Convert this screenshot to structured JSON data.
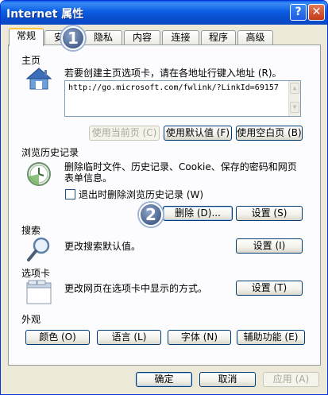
{
  "window": {
    "title": "Internet 属性",
    "help_glyph": "?",
    "close_glyph": "✕"
  },
  "tabs": [
    {
      "label": "常规",
      "active": true
    },
    {
      "label": "安全"
    },
    {
      "label": "隐私"
    },
    {
      "label": "内容"
    },
    {
      "label": "连接"
    },
    {
      "label": "程序"
    },
    {
      "label": "高级"
    }
  ],
  "homepage": {
    "title": "主页",
    "description": "若要创建主页选项卡，请在各地址行键入地址 (R)。",
    "url": "http://go.microsoft.com/fwlink/?LinkId=69157",
    "use_current": "使用当前页 (C)",
    "use_default": "使用默认值 (F)",
    "use_blank": "使用空白页 (B)"
  },
  "history": {
    "title": "浏览历史记录",
    "description_line1": "删除临时文件、历史记录、Cookie、保存的密码和网页",
    "description_line2": "表单信息。",
    "checkbox_label": "退出时删除浏览历史记录 (W)",
    "checkbox_checked": false,
    "delete_button": "删除 (D)...",
    "settings_button": "设置 (S)"
  },
  "search": {
    "title": "搜索",
    "description": "更改搜索默认值。",
    "settings_button": "设置 (I)"
  },
  "tabs_section": {
    "title": "选项卡",
    "description": "更改网页在选项卡中显示的方式。",
    "settings_button": "设置 (T)"
  },
  "appearance": {
    "title": "外观",
    "colors_button": "颜色 (O)",
    "languages_button": "语言 (L)",
    "fonts_button": "字体 (N)",
    "accessibility_button": "辅助功能 (E)"
  },
  "footer": {
    "ok_button": "确定",
    "cancel_button": "取消",
    "apply_button": "应用 (A)"
  },
  "annotations": {
    "step1": "1",
    "step2": "2"
  },
  "colors": {
    "titlebar": "#0a5fe6",
    "badge": "#4a6491",
    "dialog_bg": "#ece9d8",
    "panel_bg": "#fcfcfe"
  }
}
